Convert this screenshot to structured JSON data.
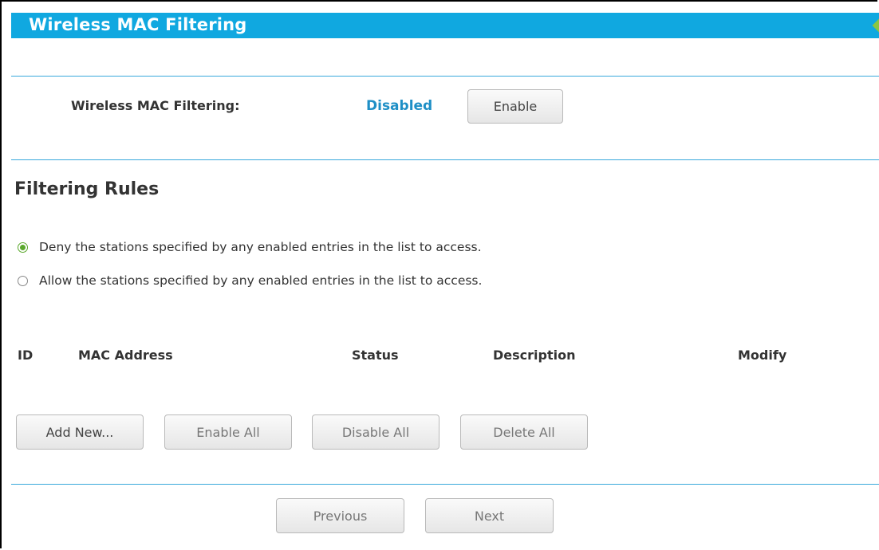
{
  "header": {
    "title": "Wireless MAC Filtering"
  },
  "filtering": {
    "label": "Wireless MAC Filtering:",
    "status": "Disabled",
    "enable_button": "Enable"
  },
  "rules": {
    "title": "Filtering Rules",
    "options": [
      {
        "label": "Deny the stations specified by any enabled entries in the list to access.",
        "checked": true
      },
      {
        "label": "Allow the stations specified by any enabled entries in the list to access.",
        "checked": false
      }
    ]
  },
  "table": {
    "columns": [
      "ID",
      "MAC Address",
      "Status",
      "Description",
      "Modify"
    ]
  },
  "actions": {
    "add_new": "Add New...",
    "enable_all": "Enable All",
    "disable_all": "Disable All",
    "delete_all": "Delete All"
  },
  "nav": {
    "previous": "Previous",
    "next": "Next"
  },
  "colors": {
    "header_bg": "#10a8e0",
    "status_text": "#1e8fc6",
    "divider": "#39a9dc",
    "radio_checked": "#5aa82c"
  }
}
